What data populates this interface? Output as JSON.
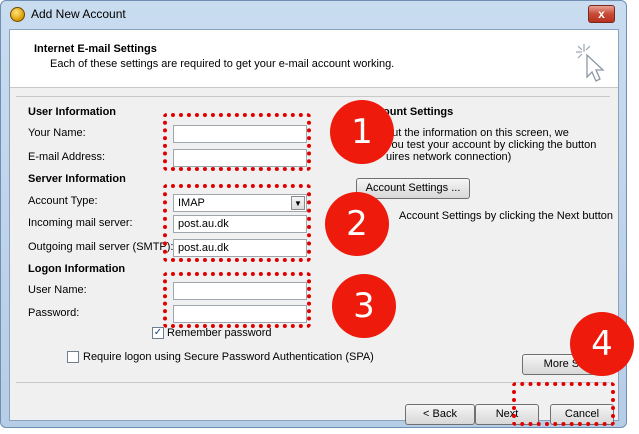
{
  "window": {
    "title": "Add New Account",
    "close_symbol": "x"
  },
  "header": {
    "title": "Internet E-mail Settings",
    "subtitle": "Each of these settings are required to get your e-mail account working."
  },
  "user_info": {
    "section": "User Information",
    "name_label": "Your Name:",
    "name_value": "",
    "email_label": "E-mail Address:",
    "email_value": ""
  },
  "server_info": {
    "section": "Server Information",
    "account_type_label": "Account Type:",
    "account_type_value": "IMAP",
    "incoming_label": "Incoming mail server:",
    "incoming_value": "post.au.dk",
    "outgoing_label": "Outgoing mail server (SMTP):",
    "outgoing_value": "post.au.dk"
  },
  "logon_info": {
    "section": "Logon Information",
    "user_label": "User Name:",
    "user_value": "",
    "password_label": "Password:",
    "password_value": "",
    "remember_label": "Remember password",
    "remember_checked": true,
    "spa_label": "Require logon using Secure Password Authentication (SPA)",
    "spa_checked": false
  },
  "test_panel": {
    "title_partial": "ount Settings",
    "line1": "out the information on this screen, we",
    "line2": "you test your account by clicking the button",
    "line3": "uires network connection)",
    "test_button": "Account Settings ...",
    "auto_test_text": "Account Settings by clicking the Next button",
    "more_button": "More Set"
  },
  "footer": {
    "back": "< Back",
    "next": "Next",
    "cancel": "Cancel"
  },
  "callouts": [
    "1",
    "2",
    "3",
    "4"
  ],
  "colors": {
    "callout": "#ee1a0c",
    "window_frame": "#b6cde6"
  }
}
